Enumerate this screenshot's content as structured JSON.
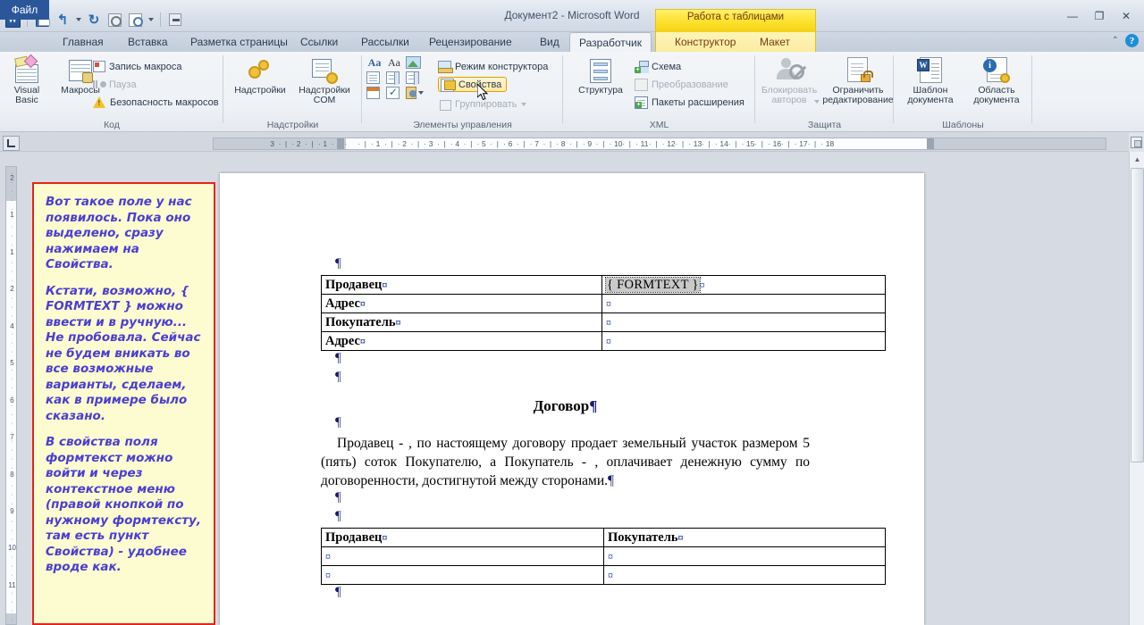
{
  "window": {
    "title": "Документ2 - Microsoft Word",
    "contextual_tab_title": "Работа с таблицами",
    "minimize": "—",
    "restore": "❐",
    "close": "✕",
    "help": "?",
    "collapse_ribbon": "⌃"
  },
  "quick_access": {
    "app_logo": "W",
    "items": [
      {
        "name": "save-icon",
        "label": "Сохранить"
      },
      {
        "name": "undo-icon",
        "label": "Отменить"
      },
      {
        "name": "redo-icon",
        "label": "Вернуть"
      },
      {
        "name": "print-icon",
        "label": "Печать"
      },
      {
        "name": "print-preview-icon",
        "label": "Предварительный просмотр"
      },
      {
        "name": "customize-qat-icon",
        "label": "Настройка панели быстрого доступа"
      }
    ]
  },
  "tabs": [
    {
      "label": "Файл",
      "kind": "file"
    },
    {
      "label": "Главная",
      "kind": "normal"
    },
    {
      "label": "Вставка",
      "kind": "normal"
    },
    {
      "label": "Разметка страницы",
      "kind": "normal"
    },
    {
      "label": "Ссылки",
      "kind": "normal"
    },
    {
      "label": "Рассылки",
      "kind": "normal"
    },
    {
      "label": "Рецензирование",
      "kind": "normal"
    },
    {
      "label": "Вид",
      "kind": "normal"
    },
    {
      "label": "Разработчик",
      "kind": "active"
    },
    {
      "label": "Конструктор",
      "kind": "contextual"
    },
    {
      "label": "Макет",
      "kind": "contextual"
    }
  ],
  "ribbon": {
    "groups": [
      {
        "name": "code",
        "label": "Код",
        "big_buttons": [
          {
            "label": "Visual Basic",
            "icon": "visual-basic-icon"
          },
          {
            "label": "Макросы",
            "icon": "macros-icon"
          }
        ],
        "small_buttons": [
          {
            "label": "Запись макроса",
            "icon": "record-macro-icon",
            "disabled": false
          },
          {
            "label": "Пауза",
            "icon": "pause-icon",
            "disabled": true
          },
          {
            "label": "Безопасность макросов",
            "icon": "macro-security-icon",
            "disabled": false
          }
        ]
      },
      {
        "name": "addins",
        "label": "Надстройки",
        "big_buttons": [
          {
            "label": "Надстройки",
            "icon": "addins-icon"
          },
          {
            "label": "Надстройки COM",
            "icon": "com-addins-icon"
          }
        ],
        "small_buttons": []
      },
      {
        "name": "controls",
        "label": "Элементы управления",
        "gallery_icons": [
          "rich-text-content-control-icon",
          "plain-text-content-control-icon",
          "picture-content-control-icon",
          "building-block-gallery-icon",
          "combo-box-content-control-icon",
          "drop-down-list-content-control-icon",
          "date-picker-content-control-icon",
          "check-box-content-control-icon",
          "legacy-tools-icon"
        ],
        "small_buttons": [
          {
            "label": "Режим конструктора",
            "icon": "design-mode-icon",
            "disabled": false,
            "highlighted": false
          },
          {
            "label": "Свойства",
            "icon": "properties-icon",
            "disabled": false,
            "highlighted": true
          },
          {
            "label": "Группировать",
            "icon": "group-icon",
            "disabled": true,
            "highlighted": false
          }
        ]
      },
      {
        "name": "xml",
        "label": "XML",
        "big_buttons": [
          {
            "label": "Структура",
            "icon": "structure-icon"
          }
        ],
        "small_buttons": [
          {
            "label": "Схема",
            "icon": "schema-icon",
            "disabled": false
          },
          {
            "label": "Преобразование",
            "icon": "transformation-icon",
            "disabled": true
          },
          {
            "label": "Пакеты расширения",
            "icon": "expansion-packs-icon",
            "disabled": false
          }
        ]
      },
      {
        "name": "protect",
        "label": "Защита",
        "big_buttons": [
          {
            "label": "Блокировать авторов",
            "icon": "block-authors-icon",
            "disabled": true
          },
          {
            "label": "Ограничить редактирование",
            "icon": "restrict-editing-icon",
            "disabled": false
          }
        ],
        "small_buttons": []
      },
      {
        "name": "templates",
        "label": "Шаблоны",
        "big_buttons": [
          {
            "label": "Шаблон документа",
            "icon": "document-template-icon"
          },
          {
            "label": "Область документа",
            "icon": "document-panel-icon"
          }
        ],
        "small_buttons": []
      }
    ]
  },
  "ruler": {
    "tab_stop_selector": "L",
    "horizontal_ticks_left": [
      "3",
      "2",
      "1"
    ],
    "horizontal_ticks_right": [
      "1",
      "2",
      "3",
      "4",
      "5",
      "6",
      "7",
      "8",
      "9",
      "10",
      "11",
      "12",
      "13",
      "14",
      "15",
      "16",
      "17",
      "18"
    ],
    "vertical_ticks": [
      "2",
      "1",
      "1",
      "2",
      "4",
      "5",
      "6",
      "7",
      "8",
      "9",
      "10",
      "11"
    ]
  },
  "note": {
    "paragraphs": [
      "Вот такое поле у нас появилось. Пока оно выделено, сразу нажимаем на Свойства.",
      "Кстати, возможно, { FORMTEXT } можно ввести и в ручную... Не пробовала. Сейчас не будем вникать во все возможные варианты, сделаем, как в примере было сказано.",
      "В свойства поля формтекст можно войти и через контекстное меню (правой кнопкой по нужному формтексту, там есть пункт Свойства) - удобнее вроде как."
    ],
    "border_color": "#e8231a",
    "background_color": "#fdfbd0",
    "text_color": "#4a3fd0"
  },
  "document": {
    "table_top": {
      "rows": [
        {
          "label": "Продавец",
          "value": "{ FORMTEXT }",
          "value_is_field": true
        },
        {
          "label": "Адрес",
          "value": "",
          "value_is_field": false
        },
        {
          "label": "Покупатель",
          "value": "",
          "value_is_field": false
        },
        {
          "label": "Адрес",
          "value": "",
          "value_is_field": false
        }
      ]
    },
    "title": "Договор",
    "body": "Продавец - , по настоящему договору продает земельный участок размером 5 (пять) соток Покупателю, а Покупатель - , оплачивает денежную сумму по договоренности, достигнутой между сторонами.",
    "table_bottom": {
      "headers": [
        "Продавец",
        "Покупатель"
      ],
      "rows": [
        [
          "",
          ""
        ],
        [
          "",
          ""
        ]
      ]
    },
    "marks": {
      "paragraph": "¶",
      "cell_end": "¤",
      "space_dot": "·"
    }
  },
  "scrollbar": {
    "up_arrow": "▲",
    "split_handle": "split-window-icon"
  }
}
